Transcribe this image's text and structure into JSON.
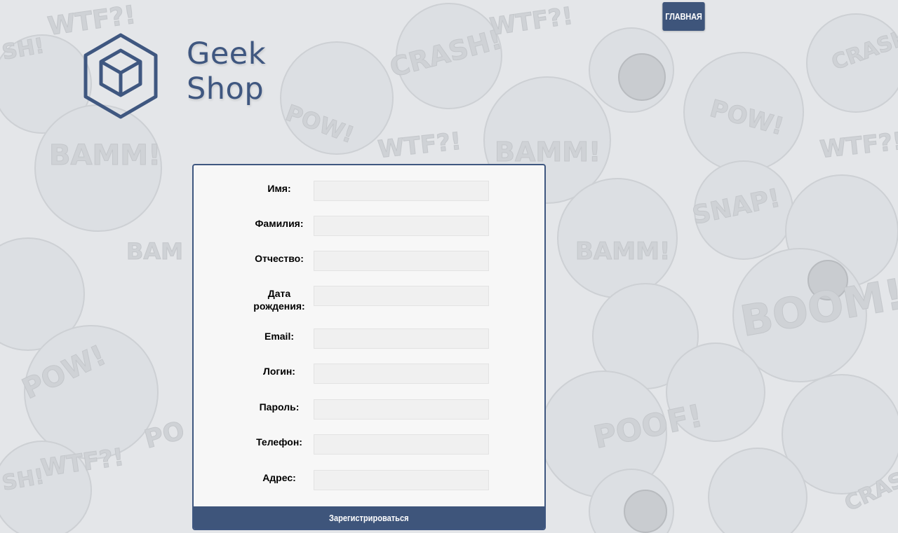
{
  "nav": {
    "home_label": "ГЛАВНАЯ"
  },
  "logo": {
    "line1": "Geek",
    "line2": "Shop"
  },
  "form": {
    "fields": [
      {
        "label": "Имя:",
        "value": ""
      },
      {
        "label": "Фамилия:",
        "value": ""
      },
      {
        "label": "Отчество:",
        "value": ""
      },
      {
        "label": "Дата рождения:",
        "value": ""
      },
      {
        "label": "Email:",
        "value": ""
      },
      {
        "label": "Логин:",
        "value": ""
      },
      {
        "label": "Пароль:",
        "value": ""
      },
      {
        "label": "Телефон:",
        "value": ""
      },
      {
        "label": "Адрес:",
        "value": ""
      }
    ],
    "submit_label": "Зарегистрироваться"
  },
  "background": {
    "words": [
      "BAMM!",
      "WTF?!",
      "POW!",
      "CRASH!",
      "BOOM!",
      "POOF!",
      "SNAP!"
    ]
  },
  "colors": {
    "accent": "#3e557b",
    "card_bg": "#f7f7f7",
    "page_bg": "#e4e6e9"
  }
}
